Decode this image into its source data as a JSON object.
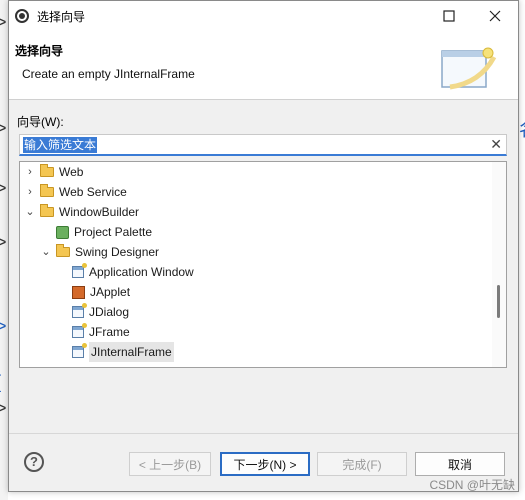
{
  "window": {
    "title": "选择向导"
  },
  "header": {
    "title": "选择向导",
    "description": "Create an empty JInternalFrame"
  },
  "filter": {
    "label": "向导(W):",
    "value": "输入筛选文本"
  },
  "tree": {
    "items": [
      {
        "label": "Web",
        "expanded": false
      },
      {
        "label": "Web Service",
        "expanded": false
      },
      {
        "label": "WindowBuilder",
        "expanded": true
      },
      {
        "label": "Project Palette"
      },
      {
        "label": "Swing Designer",
        "expanded": true
      },
      {
        "label": "Application Window"
      },
      {
        "label": "JApplet"
      },
      {
        "label": "JDialog"
      },
      {
        "label": "JFrame"
      },
      {
        "label": "JInternalFrame",
        "selected": true
      }
    ]
  },
  "buttons": {
    "back": "< 上一步(B)",
    "next": "下一步(N) >",
    "finish": "完成(F)",
    "cancel": "取消"
  },
  "watermark": "CSDN @叶无缺",
  "background": {
    "right_glyph": "名"
  },
  "colors": {
    "accent": "#3a7bd5",
    "folder": "#f4c652"
  }
}
